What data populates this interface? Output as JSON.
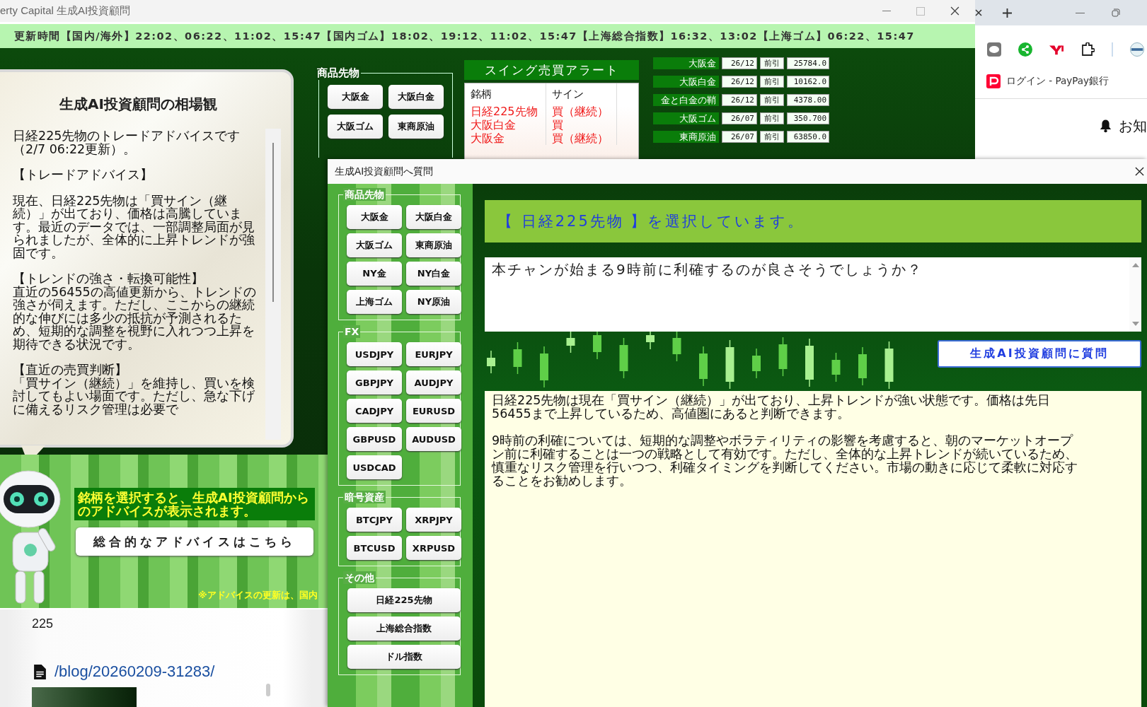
{
  "app_window": {
    "title": "erty Capital 生成AI投資顧問",
    "update_bar": "更新時間【国内/海外】22:02、06:22、11:02、15:47【国内ゴム】18:02、19:12、11:02、15:47【上海総合指数】16:32、13:02【上海ゴム】06:22、15:47"
  },
  "advice_card": {
    "title": "生成AI投資顧問の相場観",
    "blocks": [
      [
        "日経225先物のトレードアドバイスです（2/7 06:22更新）。"
      ],
      [
        "【トレードアドバイス】"
      ],
      [
        "現在、日経225先物は「買サイン（継続）」が出ており、価格は高騰しています。最近のデータでは、一部調整局面が見られましたが、全体的に上昇トレンドが強固です。"
      ],
      [
        "【トレンドの強さ・転換可能性】",
        "直近の56455の高値更新から、トレンドの強さが伺えます。ただし、ここからの継続的な伸びには多少の抵抗が予測されるため、短期的な調整を視野に入れつつ上昇を期待できる状況です。"
      ],
      [
        "【直近の売買判断】",
        "「買サイン（継続）」を維持し、買いを検討してもよい場面です。ただし、急な下げに備えるリスク管理は必要で"
      ]
    ]
  },
  "hint": "銘柄を選択すると、生成AI投資顧問からのアドバイスが表示されます。",
  "overall_button": "総合的なアドバイスはこちら",
  "note": "※アドバイスの更新は、国内",
  "commodity_group": {
    "label": "商品先物",
    "buttons": [
      "大阪金",
      "大阪白金",
      "大阪ゴム",
      "東商原油"
    ]
  },
  "swing_alert": {
    "title": "スイング売買アラート",
    "columns": [
      "銘柄",
      "サイン"
    ],
    "rows": [
      {
        "name": "日経225先物",
        "sign": "買（継続）"
      },
      {
        "name": "大阪白金",
        "sign": "買"
      },
      {
        "name": "大阪金",
        "sign": "買（継続）"
      }
    ]
  },
  "prices": [
    {
      "name": "大阪金",
      "month": "26/12",
      "session": "前引",
      "price": "25784.0"
    },
    {
      "name": "大阪白金",
      "month": "26/12",
      "session": "前引",
      "price": "10162.0"
    },
    {
      "name": "金と白金の鞘",
      "month": "26/12",
      "session": "前引",
      "price": "4378.00"
    },
    {
      "name": "大阪ゴム",
      "month": "26/07",
      "session": "前引",
      "price": "350.700"
    },
    {
      "name": "東商原油",
      "month": "26/07",
      "session": "前引",
      "price": "63850.0"
    }
  ],
  "browser": {
    "bookmark": "ログイン - PayPay銀行",
    "notice": "お知"
  },
  "page_behind": {
    "number": "225",
    "link": "/blog/20260209-31283/"
  },
  "dialog": {
    "title": "生成AI投資顧問へ質問",
    "groups": [
      {
        "label": "商品先物",
        "kind": "pair",
        "buttons": [
          "大阪金",
          "大阪白金",
          "大阪ゴム",
          "東商原油",
          "NY金",
          "NY白金",
          "上海ゴム",
          "NY原油"
        ]
      },
      {
        "label": "FX",
        "kind": "pair",
        "buttons": [
          "USDJPY",
          "EURJPY",
          "GBPJPY",
          "AUDJPY",
          "CADJPY",
          "EURUSD",
          "GBPUSD",
          "AUDUSD",
          "USDCAD"
        ]
      },
      {
        "label": "暗号資産",
        "kind": "pair",
        "buttons": [
          "BTCJPY",
          "XRPJPY",
          "BTCUSD",
          "XRPUSD"
        ]
      },
      {
        "label": "その他",
        "kind": "wide",
        "buttons": [
          "日経225先物",
          "上海総合指数",
          "ドル指数"
        ]
      }
    ],
    "selection_header": "【 日経225先物 】を選択しています。",
    "question": "本チャンが始まる9時前に利確するのが良さそうでしょうか？",
    "ask_button": "生成AI投資顧問に質問",
    "answer": [
      "日経225先物は現在「買サイン（継続）」が出ており、上昇トレンドが強い状態です。価格は先日56455まで上昇しているため、高値圏にあると判断できます。",
      "9時前の利確については、短期的な調整やボラティリティの影響を考慮すると、朝のマーケットオープン前に利確することは一つの戦略として有効です。ただし、全体的な上昇トレンドが続いているため、慎重なリスク管理を行いつつ、利確タイミングを判断してください。市場の動きに応じて柔軟に対応することをお勧めします。"
    ]
  }
}
